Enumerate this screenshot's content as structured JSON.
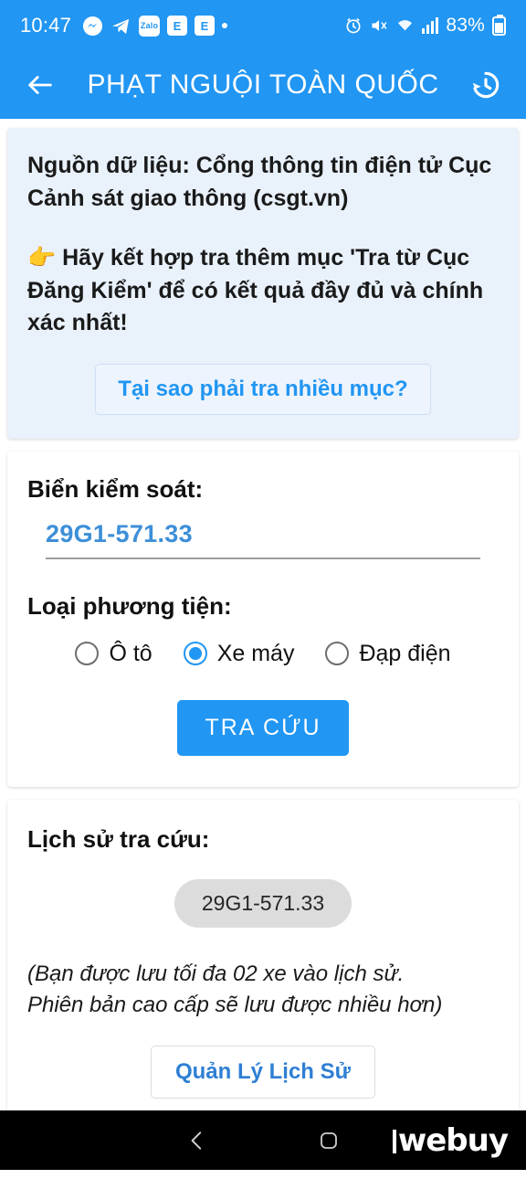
{
  "status_bar": {
    "time": "10:47",
    "battery_percent": "83%",
    "left_icons": [
      "messenger-icon",
      "telegram-icon",
      "zalo-icon",
      "email-icon",
      "email-icon",
      "dot-icon"
    ],
    "right_icons": [
      "alarm-icon",
      "mute-icon",
      "wifi-icon",
      "signal-icon",
      "battery-icon"
    ],
    "messenger_glyph": "⚡",
    "telegram_glyph": "➤",
    "zalo_glyph": "Zalo",
    "email_glyph": "E",
    "alarm_glyph": "⏰",
    "mute_glyph": "🔇"
  },
  "app_bar": {
    "back_icon": "back-arrow-icon",
    "title": "PHẠT NGUỘI TOÀN QUỐC",
    "history_icon": "history-clock-icon"
  },
  "info_card": {
    "source_text": "Nguồn dữ liệu: Cổng thông tin điện tử Cục Cảnh sát giao thông (csgt.vn)",
    "pointer_emoji": "👉",
    "advice_text": "Hãy kết hợp tra thêm mục 'Tra từ Cục Đăng Kiểm' để có kết quả đầy đủ và chính xác nhất!",
    "why_button_label": "Tại sao phải tra nhiều mục?"
  },
  "form_card": {
    "plate_label": "Biển kiểm soát:",
    "plate_value": "29G1-571.33",
    "vehicle_label": "Loại phương tiện:",
    "vehicle_options": [
      {
        "label": "Ô tô",
        "checked": false
      },
      {
        "label": "Xe máy",
        "checked": true
      },
      {
        "label": "Đạp điện",
        "checked": false
      }
    ],
    "submit_label": "TRA CỨU"
  },
  "history_card": {
    "title": "Lịch sử tra cứu:",
    "items": [
      "29G1-571.33"
    ],
    "note_line1": "(Bạn được lưu tối đa 02 xe vào lịch sử.",
    "note_line2": "Phiên bản cao cấp sẽ lưu được nhiều hơn)",
    "manage_button_label": "Quản Lý Lịch Sử"
  },
  "nav_bar": {
    "back_icon": "nav-back-icon",
    "home_icon": "nav-home-icon",
    "watermark": "webuy"
  },
  "colors": {
    "accent": "#2196f3",
    "info_card_bg": "#e9f1fb",
    "chip_bg": "#dcdcdc",
    "page_bg": "#ffffff",
    "nav_bg": "#000000"
  }
}
